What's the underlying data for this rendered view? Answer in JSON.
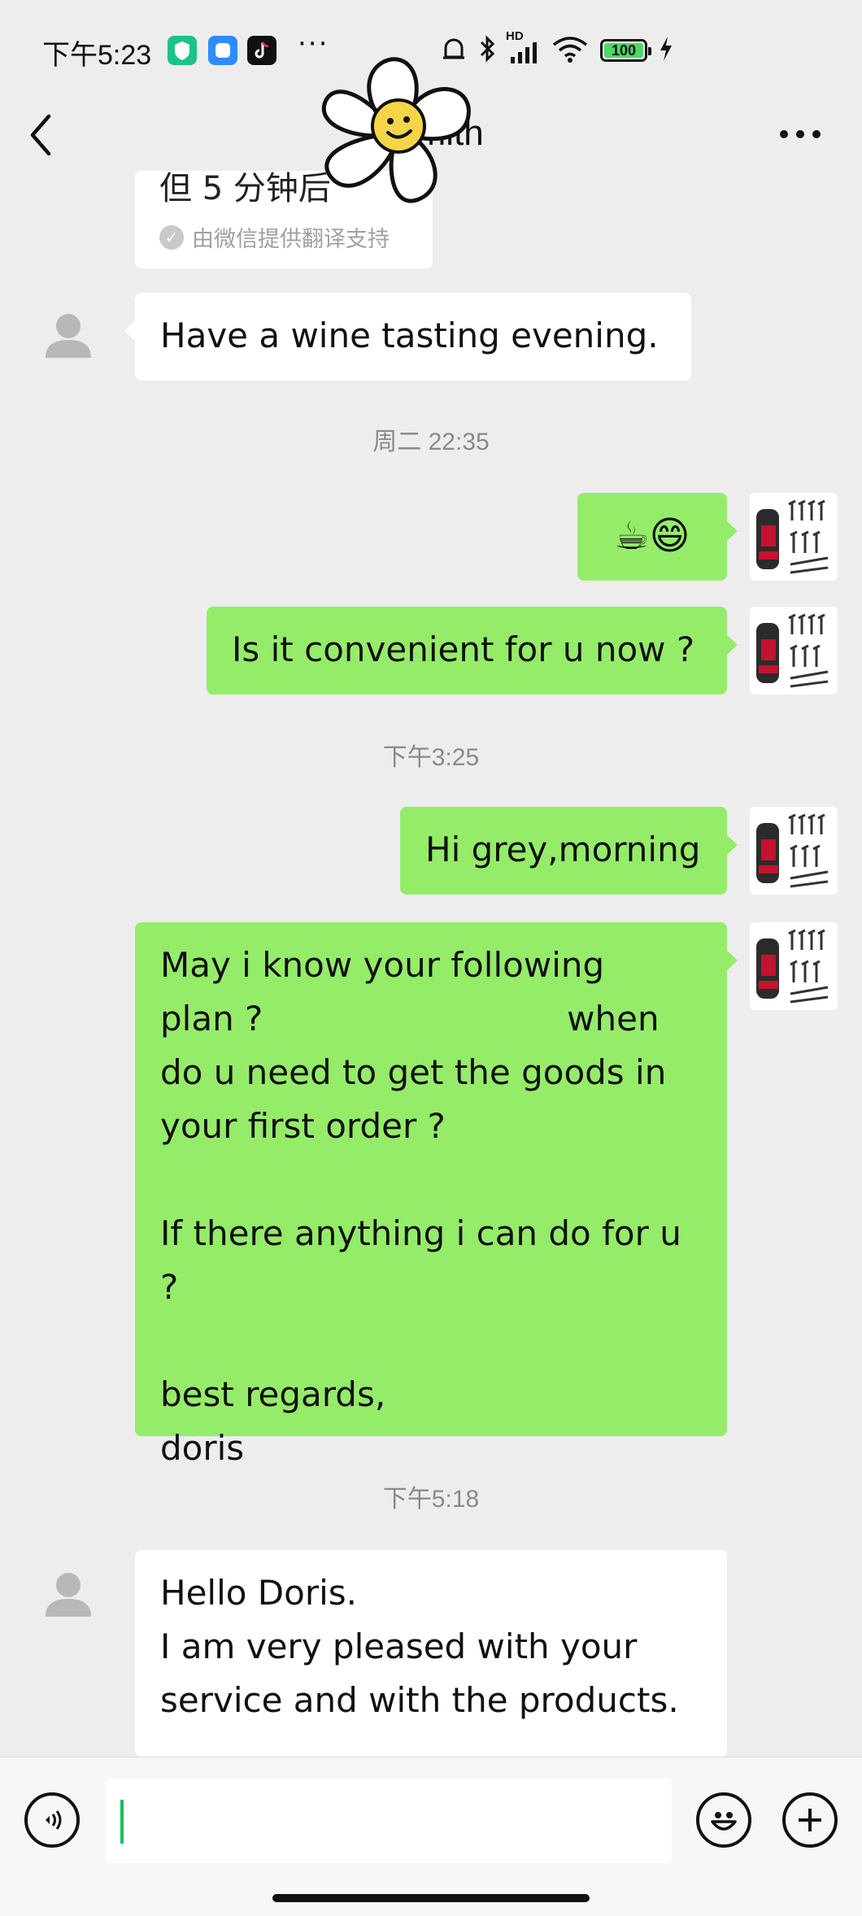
{
  "status_bar": {
    "time": "下午5:23",
    "more": "···",
    "network": "HD",
    "battery": "100"
  },
  "nav": {
    "title": "G           mith"
  },
  "translation": {
    "fragment": "但 5 分钟后",
    "note": "由微信提供翻译支持"
  },
  "messages": [
    {
      "text": "Have a wine tasting evening."
    },
    {
      "text": "☕😄"
    },
    {
      "text": "Is it convenient for u now ?"
    },
    {
      "text": "Hi grey,morning"
    },
    {
      "text": "May i know your following\nplan ?                            when\ndo u need to get the goods in\nyour first order ?\n\nIf there anything i can do for u ?\n\nbest regards,\ndoris"
    },
    {
      "text": "Hello Doris.\nI am very pleased with your\nservice and with the products."
    }
  ],
  "timestamps": [
    "周二 22:35",
    "下午3:25",
    "下午5:18"
  ],
  "colors": {
    "background": "#EDEDED",
    "green_bubble": "#95EC69",
    "white_bubble": "#FFFFFF",
    "accent": "#07C160"
  },
  "icons": {
    "back": "chevron-left-icon",
    "more": "more-icon",
    "voice": "voice-icon",
    "emoji": "emoji-icon",
    "add": "plus-icon"
  }
}
